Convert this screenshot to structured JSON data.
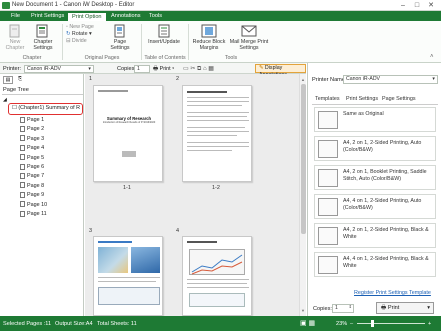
{
  "window": {
    "title": "New Document 1 - Canon iW Desktop - Editor"
  },
  "tabs": [
    "File",
    "Print Settings",
    "Print Option",
    "Annotations",
    "Tools"
  ],
  "ribbon": {
    "new_chapter": "New Chapter",
    "chapter_settings": "Chapter Settings",
    "new_page": "New Page",
    "rotate": "Rotate",
    "divide": "Divide",
    "page_settings": "Page Settings",
    "insert_update": "Insert/Update",
    "reduce_block_margins": "Reduce Block Margins",
    "mail_merge_print_settings": "Mail Merge Print Settings",
    "group_chapter": "Chapter",
    "group_original_pages": "Original Pages",
    "group_toc": "Table of Contents",
    "group_tools": "Tools"
  },
  "printer_bar": {
    "printer_label": "Printer:",
    "printer_value": "Canon iR-ADV",
    "copies_label": "Copies:",
    "copies_value": "1",
    "print_label": "Print",
    "display_annotations": "Display Annotations"
  },
  "left_panel": {
    "page_tree_label": "Page Tree",
    "chapter_item": "(Chapter1) Summary of R",
    "pages": [
      "Page 1",
      "Page 2",
      "Page 3",
      "Page 4",
      "Page 5",
      "Page 6",
      "Page 7",
      "Page 8",
      "Page 9",
      "Page 10",
      "Page 11"
    ]
  },
  "center": {
    "page_numbers": [
      "1",
      "2",
      "3",
      "4"
    ],
    "page_labels": [
      "1-1",
      "1-2"
    ],
    "doc_title_1": "Summary of Research",
    "doc_subtitle_1": "Introduction of Research Results of FY2019/2020"
  },
  "right_panel": {
    "printer_name_label": "Printer Name",
    "printer_name_value": "Canon iR-ADV",
    "tabs": [
      "Templates",
      "Print Settings",
      "Page Settings"
    ],
    "templates": [
      "Same as Original",
      "A4, 2 on 1, 2-Sided Printing, Auto (Color/B&W)",
      "A4, 2 on 1, Booklet Printing, Saddle Stitch, Auto (Color/B&W)",
      "A4, 4 on 1, 2-Sided Printing, Auto (Color/B&W)",
      "A4, 2 on 1, 2-Sided Printing, Black & White",
      "A4, 4 on 1, 2-Sided Printing, Black & White"
    ],
    "register_link": "Register Print Settings Template",
    "copies_label": "Copies:",
    "copies_value": "1",
    "print_button": "Print"
  },
  "status_bar": {
    "selected_pages": "Selected Pages :11",
    "output_size": "Output Size:A4",
    "total_sheets": "Total Sheets: 11",
    "zoom": "23%"
  },
  "colors": {
    "accent": "#1e7a34",
    "highlight": "#e03030"
  }
}
